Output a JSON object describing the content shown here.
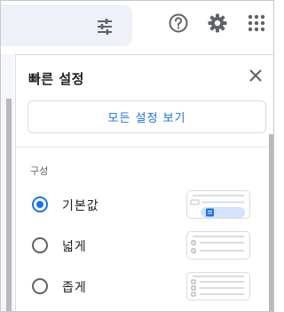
{
  "toolbar": {
    "filter_icon": "tune-icon",
    "help_icon": "help-circle-icon",
    "settings_icon": "gear-icon",
    "apps_icon": "apps-grid-icon"
  },
  "quick_settings": {
    "title": "빠른 설정",
    "close_icon": "close-icon",
    "all_settings_label": "모든 설정 보기",
    "density_label": "구성",
    "options": [
      {
        "label": "기본값",
        "selected": true
      },
      {
        "label": "넓게",
        "selected": false
      },
      {
        "label": "좁게",
        "selected": false
      }
    ]
  },
  "colors": {
    "accent": "#1a73e8",
    "icon": "#5f6368",
    "search_bg": "#eef1f8"
  }
}
